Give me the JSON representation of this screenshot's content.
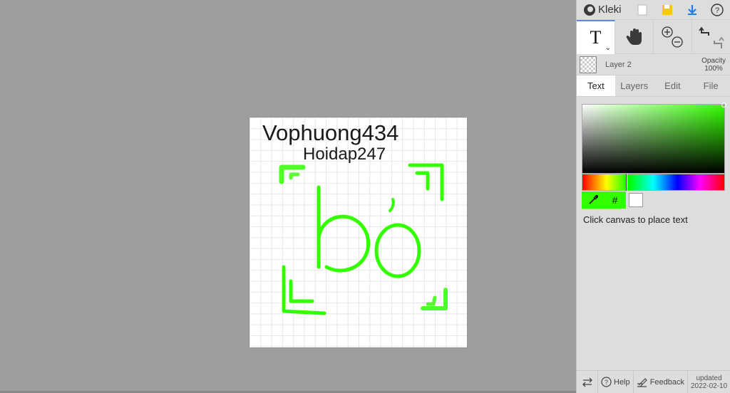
{
  "app": {
    "name": "Kleki"
  },
  "canvas": {
    "text_line1": "Vophuong434",
    "text_line2": "Hoidap247",
    "drawn_text": "bỏ",
    "stroke_color": "#33ff00"
  },
  "tools": {
    "text_tool": "T",
    "hand_tool_icon": "hand-icon",
    "zoom_icon": "zoom-in-out-icon",
    "undo_icon": "undo-icon",
    "redo_icon": "redo-icon"
  },
  "layer": {
    "name": "Layer 2",
    "opacity_label": "Opacity",
    "opacity_value": "100%"
  },
  "tabs": [
    "Text",
    "Layers",
    "Edit",
    "File"
  ],
  "active_tab": "Text",
  "color": {
    "current": "#33ff00",
    "secondary": "#ffffff",
    "hex_button": "#"
  },
  "hint": "Click canvas to place text",
  "bottom": {
    "help": "Help",
    "feedback": "Feedback",
    "updated_label": "updated",
    "updated_date": "2022-02-10"
  }
}
